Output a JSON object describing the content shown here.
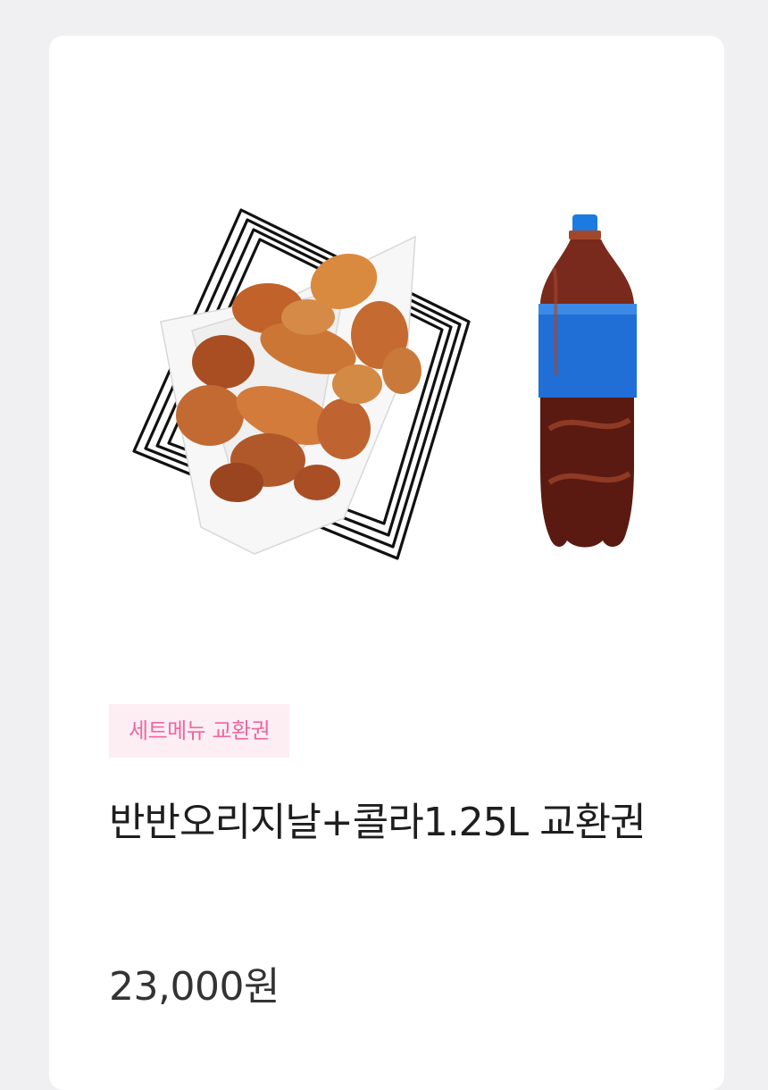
{
  "product": {
    "image_alt": "",
    "badge": "세트메뉴 교환권",
    "title": "반반오리지날+콜라1.25L 교환권",
    "price": "23,000원"
  },
  "colors": {
    "page_background": "#f0f0f2",
    "card_background": "#ffffff",
    "badge_background": "#fdeef4",
    "badge_text": "#f0679d",
    "title_text": "#1e1e1e",
    "price_text": "#333333",
    "bottle_label": "#1f6fd6",
    "bottle_cap": "#1b7be0",
    "chicken": "#c8642a"
  }
}
